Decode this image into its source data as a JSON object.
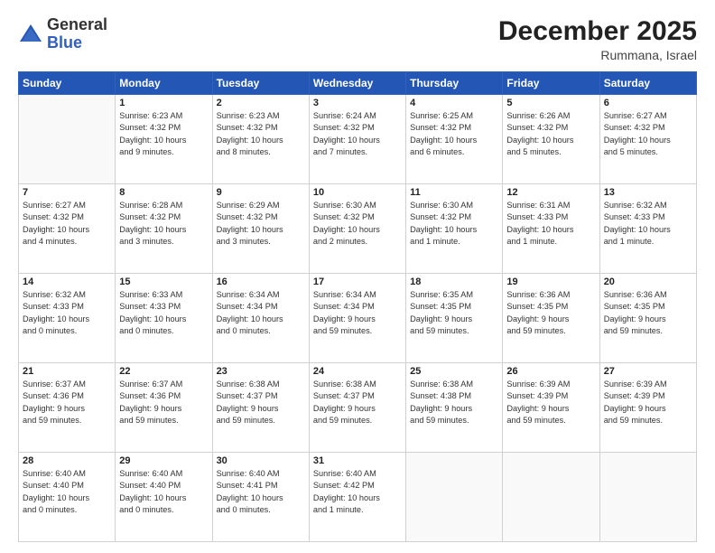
{
  "header": {
    "logo_general": "General",
    "logo_blue": "Blue",
    "month_title": "December 2025",
    "location": "Rummana, Israel"
  },
  "weekdays": [
    "Sunday",
    "Monday",
    "Tuesday",
    "Wednesday",
    "Thursday",
    "Friday",
    "Saturday"
  ],
  "weeks": [
    [
      {
        "day": "",
        "info": ""
      },
      {
        "day": "1",
        "info": "Sunrise: 6:23 AM\nSunset: 4:32 PM\nDaylight: 10 hours\nand 9 minutes."
      },
      {
        "day": "2",
        "info": "Sunrise: 6:23 AM\nSunset: 4:32 PM\nDaylight: 10 hours\nand 8 minutes."
      },
      {
        "day": "3",
        "info": "Sunrise: 6:24 AM\nSunset: 4:32 PM\nDaylight: 10 hours\nand 7 minutes."
      },
      {
        "day": "4",
        "info": "Sunrise: 6:25 AM\nSunset: 4:32 PM\nDaylight: 10 hours\nand 6 minutes."
      },
      {
        "day": "5",
        "info": "Sunrise: 6:26 AM\nSunset: 4:32 PM\nDaylight: 10 hours\nand 5 minutes."
      },
      {
        "day": "6",
        "info": "Sunrise: 6:27 AM\nSunset: 4:32 PM\nDaylight: 10 hours\nand 5 minutes."
      }
    ],
    [
      {
        "day": "7",
        "info": "Sunrise: 6:27 AM\nSunset: 4:32 PM\nDaylight: 10 hours\nand 4 minutes."
      },
      {
        "day": "8",
        "info": "Sunrise: 6:28 AM\nSunset: 4:32 PM\nDaylight: 10 hours\nand 3 minutes."
      },
      {
        "day": "9",
        "info": "Sunrise: 6:29 AM\nSunset: 4:32 PM\nDaylight: 10 hours\nand 3 minutes."
      },
      {
        "day": "10",
        "info": "Sunrise: 6:30 AM\nSunset: 4:32 PM\nDaylight: 10 hours\nand 2 minutes."
      },
      {
        "day": "11",
        "info": "Sunrise: 6:30 AM\nSunset: 4:32 PM\nDaylight: 10 hours\nand 1 minute."
      },
      {
        "day": "12",
        "info": "Sunrise: 6:31 AM\nSunset: 4:33 PM\nDaylight: 10 hours\nand 1 minute."
      },
      {
        "day": "13",
        "info": "Sunrise: 6:32 AM\nSunset: 4:33 PM\nDaylight: 10 hours\nand 1 minute."
      }
    ],
    [
      {
        "day": "14",
        "info": "Sunrise: 6:32 AM\nSunset: 4:33 PM\nDaylight: 10 hours\nand 0 minutes."
      },
      {
        "day": "15",
        "info": "Sunrise: 6:33 AM\nSunset: 4:33 PM\nDaylight: 10 hours\nand 0 minutes."
      },
      {
        "day": "16",
        "info": "Sunrise: 6:34 AM\nSunset: 4:34 PM\nDaylight: 10 hours\nand 0 minutes."
      },
      {
        "day": "17",
        "info": "Sunrise: 6:34 AM\nSunset: 4:34 PM\nDaylight: 9 hours\nand 59 minutes."
      },
      {
        "day": "18",
        "info": "Sunrise: 6:35 AM\nSunset: 4:35 PM\nDaylight: 9 hours\nand 59 minutes."
      },
      {
        "day": "19",
        "info": "Sunrise: 6:36 AM\nSunset: 4:35 PM\nDaylight: 9 hours\nand 59 minutes."
      },
      {
        "day": "20",
        "info": "Sunrise: 6:36 AM\nSunset: 4:35 PM\nDaylight: 9 hours\nand 59 minutes."
      }
    ],
    [
      {
        "day": "21",
        "info": "Sunrise: 6:37 AM\nSunset: 4:36 PM\nDaylight: 9 hours\nand 59 minutes."
      },
      {
        "day": "22",
        "info": "Sunrise: 6:37 AM\nSunset: 4:36 PM\nDaylight: 9 hours\nand 59 minutes."
      },
      {
        "day": "23",
        "info": "Sunrise: 6:38 AM\nSunset: 4:37 PM\nDaylight: 9 hours\nand 59 minutes."
      },
      {
        "day": "24",
        "info": "Sunrise: 6:38 AM\nSunset: 4:37 PM\nDaylight: 9 hours\nand 59 minutes."
      },
      {
        "day": "25",
        "info": "Sunrise: 6:38 AM\nSunset: 4:38 PM\nDaylight: 9 hours\nand 59 minutes."
      },
      {
        "day": "26",
        "info": "Sunrise: 6:39 AM\nSunset: 4:39 PM\nDaylight: 9 hours\nand 59 minutes."
      },
      {
        "day": "27",
        "info": "Sunrise: 6:39 AM\nSunset: 4:39 PM\nDaylight: 9 hours\nand 59 minutes."
      }
    ],
    [
      {
        "day": "28",
        "info": "Sunrise: 6:40 AM\nSunset: 4:40 PM\nDaylight: 10 hours\nand 0 minutes."
      },
      {
        "day": "29",
        "info": "Sunrise: 6:40 AM\nSunset: 4:40 PM\nDaylight: 10 hours\nand 0 minutes."
      },
      {
        "day": "30",
        "info": "Sunrise: 6:40 AM\nSunset: 4:41 PM\nDaylight: 10 hours\nand 0 minutes."
      },
      {
        "day": "31",
        "info": "Sunrise: 6:40 AM\nSunset: 4:42 PM\nDaylight: 10 hours\nand 1 minute."
      },
      {
        "day": "",
        "info": ""
      },
      {
        "day": "",
        "info": ""
      },
      {
        "day": "",
        "info": ""
      }
    ]
  ]
}
